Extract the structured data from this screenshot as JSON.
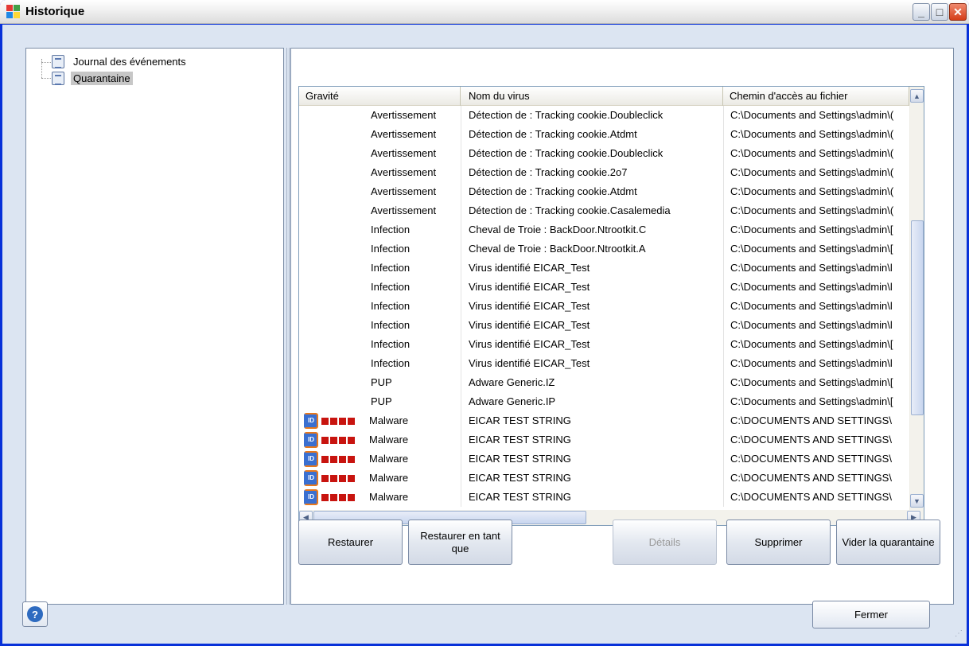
{
  "window": {
    "title": "Historique",
    "controls": {
      "minimize": "_",
      "maximize": "□",
      "close": "✕"
    }
  },
  "tree": {
    "items": [
      {
        "label": "Journal des événements",
        "icon": "log-book-icon",
        "selected": false
      },
      {
        "label": "Quarantaine",
        "icon": "log-book-icon",
        "selected": true
      }
    ]
  },
  "table": {
    "headers": [
      "Gravité",
      "Nom du virus",
      "Chemin d'accès au fichier"
    ],
    "rows": [
      {
        "severity": "Avertissement",
        "name": "Détection de : Tracking cookie.Doubleclick",
        "path": "C:\\Documents and Settings\\admin\\(",
        "badge": false
      },
      {
        "severity": "Avertissement",
        "name": "Détection de : Tracking cookie.Atdmt",
        "path": "C:\\Documents and Settings\\admin\\(",
        "badge": false
      },
      {
        "severity": "Avertissement",
        "name": "Détection de : Tracking cookie.Doubleclick",
        "path": "C:\\Documents and Settings\\admin\\(",
        "badge": false
      },
      {
        "severity": "Avertissement",
        "name": "Détection de : Tracking cookie.2o7",
        "path": "C:\\Documents and Settings\\admin\\(",
        "badge": false
      },
      {
        "severity": "Avertissement",
        "name": "Détection de : Tracking cookie.Atdmt",
        "path": "C:\\Documents and Settings\\admin\\(",
        "badge": false
      },
      {
        "severity": "Avertissement",
        "name": "Détection de : Tracking cookie.Casalemedia",
        "path": "C:\\Documents and Settings\\admin\\(",
        "badge": false
      },
      {
        "severity": "Infection",
        "name": "Cheval de Troie : BackDoor.Ntrootkit.C",
        "path": "C:\\Documents and Settings\\admin\\[",
        "badge": false
      },
      {
        "severity": "Infection",
        "name": "Cheval de Troie : BackDoor.Ntrootkit.A",
        "path": "C:\\Documents and Settings\\admin\\[",
        "badge": false
      },
      {
        "severity": "Infection",
        "name": "Virus identifié EICAR_Test",
        "path": "C:\\Documents and Settings\\admin\\l",
        "badge": false
      },
      {
        "severity": "Infection",
        "name": "Virus identifié EICAR_Test",
        "path": "C:\\Documents and Settings\\admin\\l",
        "badge": false
      },
      {
        "severity": "Infection",
        "name": "Virus identifié EICAR_Test",
        "path": "C:\\Documents and Settings\\admin\\l",
        "badge": false
      },
      {
        "severity": "Infection",
        "name": "Virus identifié EICAR_Test",
        "path": "C:\\Documents and Settings\\admin\\l",
        "badge": false
      },
      {
        "severity": "Infection",
        "name": "Virus identifié EICAR_Test",
        "path": "C:\\Documents and Settings\\admin\\[",
        "badge": false
      },
      {
        "severity": "Infection",
        "name": "Virus identifié EICAR_Test",
        "path": "C:\\Documents and Settings\\admin\\l",
        "badge": false
      },
      {
        "severity": "PUP",
        "name": "Adware Generic.IZ",
        "path": "C:\\Documents and Settings\\admin\\[",
        "badge": false
      },
      {
        "severity": "PUP",
        "name": "Adware Generic.IP",
        "path": "C:\\Documents and Settings\\admin\\[",
        "badge": false
      },
      {
        "severity": "Malware",
        "name": "EICAR TEST STRING",
        "path": "C:\\DOCUMENTS AND SETTINGS\\",
        "badge": true,
        "badge_text": "ID"
      },
      {
        "severity": "Malware",
        "name": "EICAR TEST STRING",
        "path": "C:\\DOCUMENTS AND SETTINGS\\",
        "badge": true,
        "badge_text": "ID"
      },
      {
        "severity": "Malware",
        "name": "EICAR TEST STRING",
        "path": "C:\\DOCUMENTS AND SETTINGS\\",
        "badge": true,
        "badge_text": "ID"
      },
      {
        "severity": "Malware",
        "name": "EICAR TEST STRING",
        "path": "C:\\DOCUMENTS AND SETTINGS\\",
        "badge": true,
        "badge_text": "ID"
      },
      {
        "severity": "Malware",
        "name": "EICAR TEST STRING",
        "path": "C:\\DOCUMENTS AND SETTINGS\\",
        "badge": true,
        "badge_text": "ID"
      }
    ]
  },
  "buttons": {
    "restore": "Restaurer",
    "restore_as": "Restaurer en tant que",
    "details": "Détails",
    "delete": "Supprimer",
    "empty_quarantine": "Vider la quarantaine",
    "close": "Fermer",
    "help": "?"
  },
  "scroll": {
    "up": "▲",
    "down": "▼",
    "left": "◀",
    "right": "▶"
  },
  "colors": {
    "selected": "#c7c7c7",
    "severity_square": "#c8140f",
    "window_bg": "#dce5f2"
  }
}
